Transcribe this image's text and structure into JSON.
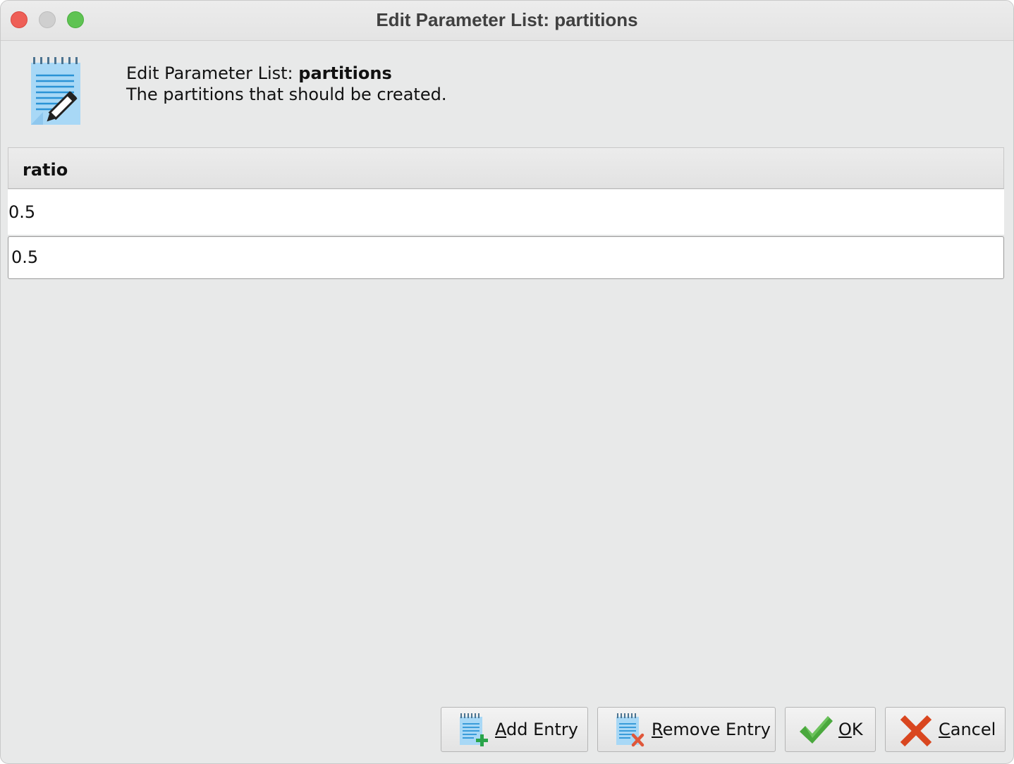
{
  "window": {
    "title": "Edit Parameter List: partitions"
  },
  "header": {
    "title_prefix": "Edit Parameter List: ",
    "title_name": "partitions",
    "description": "The partitions that should be created.",
    "icon": "notepad-edit-icon"
  },
  "table": {
    "columns": [
      "ratio"
    ],
    "rows": [
      {
        "ratio": "0.5"
      },
      {
        "ratio": "0.5",
        "editing": true
      }
    ]
  },
  "buttons": {
    "add": {
      "mnemonic": "A",
      "rest": "dd Entry",
      "icon": "notepad-add-icon"
    },
    "remove": {
      "mnemonic": "R",
      "rest": "emove Entry",
      "icon": "notepad-remove-icon"
    },
    "ok": {
      "mnemonic": "O",
      "rest": "K",
      "icon": "checkmark-icon"
    },
    "cancel": {
      "mnemonic": "C",
      "rest": "ancel",
      "icon": "x-icon"
    }
  },
  "colors": {
    "close": "#ee5f57",
    "minimize": "#cfcfcf",
    "maximize": "#5fc353",
    "ok_green": "#4aa83d",
    "cancel_red": "#d9461f"
  }
}
